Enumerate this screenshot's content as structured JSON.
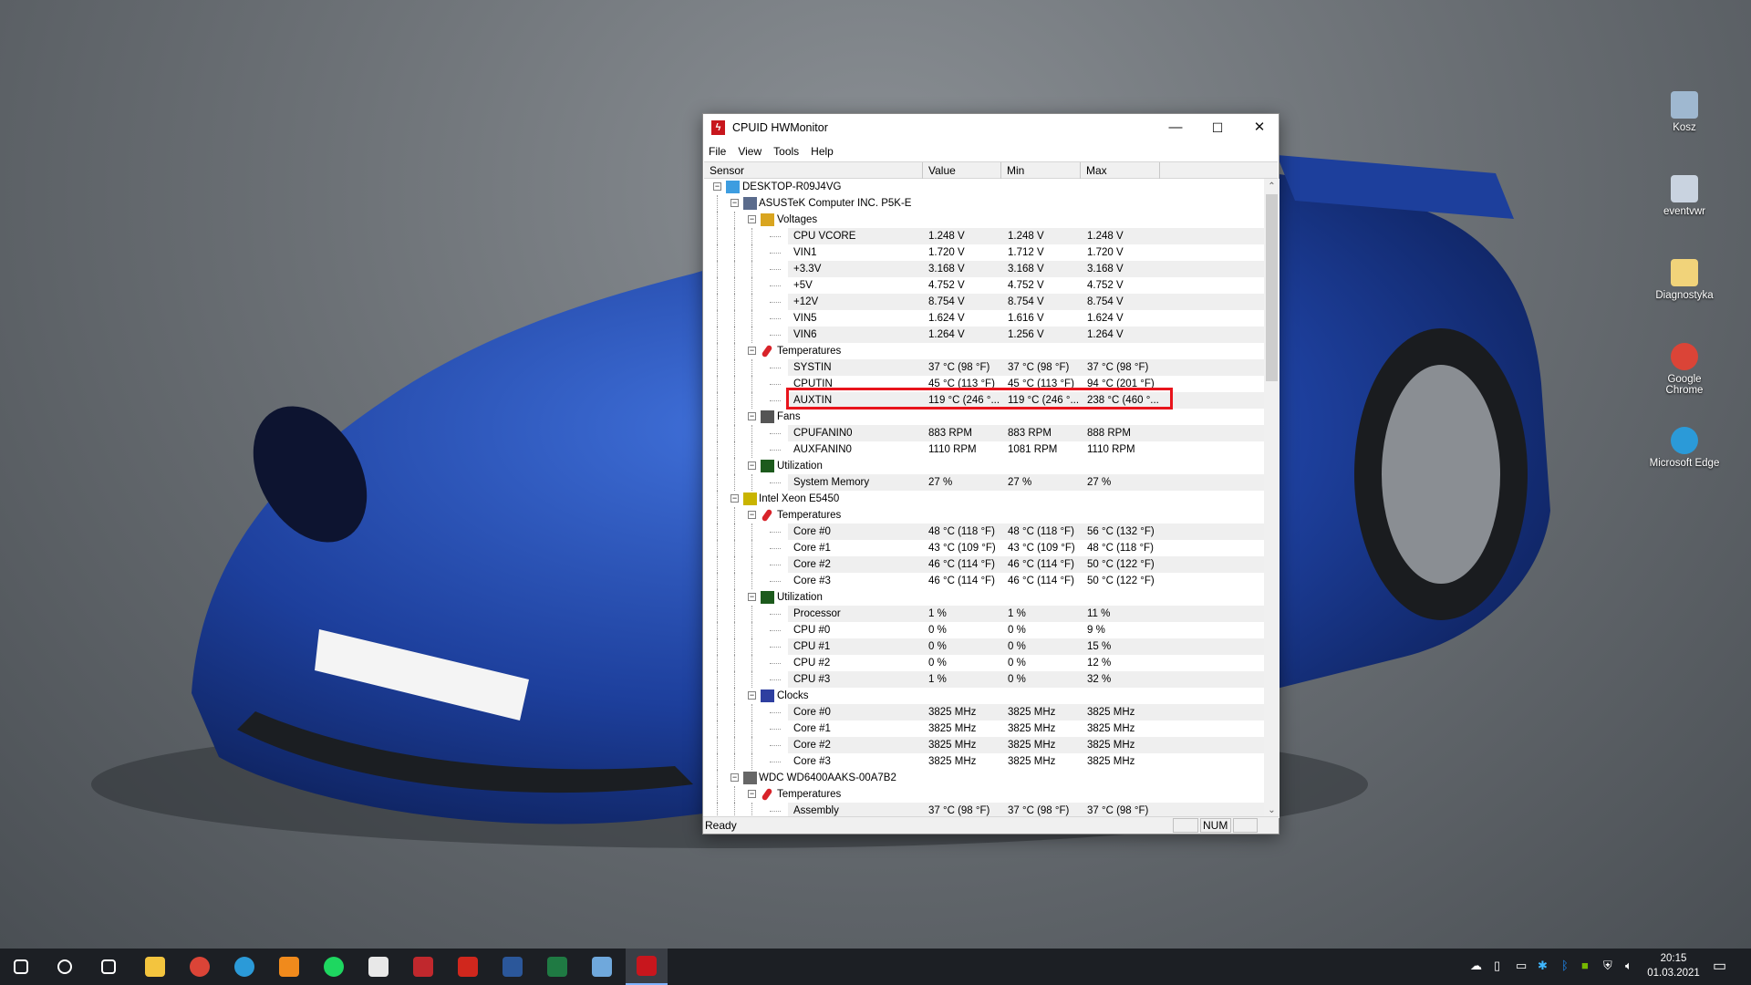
{
  "window": {
    "title": "CPUID HWMonitor",
    "minimize": "—",
    "maximize": "☐",
    "close": "✕"
  },
  "menu": [
    "File",
    "View",
    "Tools",
    "Help"
  ],
  "columns": [
    "Sensor",
    "Value",
    "Min",
    "Max"
  ],
  "rows": [
    {
      "level": 0,
      "kind": "node",
      "icon": "computer-icon",
      "label": "DESKTOP-R09J4VG"
    },
    {
      "level": 1,
      "kind": "node",
      "icon": "motherboard-icon",
      "label": "ASUSTeK Computer INC. P5K-E"
    },
    {
      "level": 2,
      "kind": "node",
      "icon": "voltage-icon",
      "label": "Voltages"
    },
    {
      "kind": "leaf",
      "band": true,
      "label": "CPU VCORE",
      "value": "1.248 V",
      "min": "1.248 V",
      "max": "1.248 V"
    },
    {
      "kind": "leaf",
      "band": false,
      "label": "VIN1",
      "value": "1.720 V",
      "min": "1.712 V",
      "max": "1.720 V"
    },
    {
      "kind": "leaf",
      "band": true,
      "label": "+3.3V",
      "value": "3.168 V",
      "min": "3.168 V",
      "max": "3.168 V"
    },
    {
      "kind": "leaf",
      "band": false,
      "label": "+5V",
      "value": "4.752 V",
      "min": "4.752 V",
      "max": "4.752 V"
    },
    {
      "kind": "leaf",
      "band": true,
      "label": "+12V",
      "value": "8.754 V",
      "min": "8.754 V",
      "max": "8.754 V"
    },
    {
      "kind": "leaf",
      "band": false,
      "label": "VIN5",
      "value": "1.624 V",
      "min": "1.616 V",
      "max": "1.624 V"
    },
    {
      "kind": "leaf",
      "band": true,
      "label": "VIN6",
      "value": "1.264 V",
      "min": "1.256 V",
      "max": "1.264 V"
    },
    {
      "level": 2,
      "kind": "node",
      "icon": "thermometer-icon",
      "label": "Temperatures"
    },
    {
      "kind": "leaf",
      "band": true,
      "label": "SYSTIN",
      "value": "37 °C  (98 °F)",
      "min": "37 °C  (98 °F)",
      "max": "37 °C  (98 °F)"
    },
    {
      "kind": "leaf",
      "band": false,
      "label": "CPUTIN",
      "value": "45 °C  (113 °F)",
      "min": "45 °C  (113 °F)",
      "max": "94 °C  (201 °F)"
    },
    {
      "kind": "leaf",
      "band": true,
      "label": "AUXTIN",
      "value": "119 °C  (246 °...",
      "min": "119 °C  (246 °...",
      "max": "238 °C  (460 °..."
    },
    {
      "level": 2,
      "kind": "node",
      "icon": "fan-icon",
      "label": "Fans"
    },
    {
      "kind": "leaf",
      "band": true,
      "label": "CPUFANIN0",
      "value": "883 RPM",
      "min": "883 RPM",
      "max": "888 RPM"
    },
    {
      "kind": "leaf",
      "band": false,
      "label": "AUXFANIN0",
      "value": "1110 RPM",
      "min": "1081 RPM",
      "max": "1110 RPM"
    },
    {
      "level": 2,
      "kind": "node",
      "icon": "utilization-icon",
      "label": "Utilization"
    },
    {
      "kind": "leaf",
      "band": true,
      "label": "System Memory",
      "value": "27 %",
      "min": "27 %",
      "max": "27 %"
    },
    {
      "level": 1,
      "kind": "node",
      "icon": "cpu-icon",
      "label": "Intel Xeon E5450"
    },
    {
      "level": 2,
      "kind": "node",
      "icon": "thermometer-icon",
      "label": "Temperatures"
    },
    {
      "kind": "leaf",
      "band": true,
      "label": "Core #0",
      "value": "48 °C  (118 °F)",
      "min": "48 °C  (118 °F)",
      "max": "56 °C  (132 °F)"
    },
    {
      "kind": "leaf",
      "band": false,
      "label": "Core #1",
      "value": "43 °C  (109 °F)",
      "min": "43 °C  (109 °F)",
      "max": "48 °C  (118 °F)"
    },
    {
      "kind": "leaf",
      "band": true,
      "label": "Core #2",
      "value": "46 °C  (114 °F)",
      "min": "46 °C  (114 °F)",
      "max": "50 °C  (122 °F)"
    },
    {
      "kind": "leaf",
      "band": false,
      "label": "Core #3",
      "value": "46 °C  (114 °F)",
      "min": "46 °C  (114 °F)",
      "max": "50 °C  (122 °F)"
    },
    {
      "level": 2,
      "kind": "node",
      "icon": "utilization-icon",
      "label": "Utilization"
    },
    {
      "kind": "leaf",
      "band": true,
      "label": "Processor",
      "value": "1 %",
      "min": "1 %",
      "max": "11 %"
    },
    {
      "kind": "leaf",
      "band": false,
      "label": "CPU #0",
      "value": "0 %",
      "min": "0 %",
      "max": "9 %"
    },
    {
      "kind": "leaf",
      "band": true,
      "label": "CPU #1",
      "value": "0 %",
      "min": "0 %",
      "max": "15 %"
    },
    {
      "kind": "leaf",
      "band": false,
      "label": "CPU #2",
      "value": "0 %",
      "min": "0 %",
      "max": "12 %"
    },
    {
      "kind": "leaf",
      "band": true,
      "label": "CPU #3",
      "value": "1 %",
      "min": "0 %",
      "max": "32 %"
    },
    {
      "level": 2,
      "kind": "node",
      "icon": "clock-icon",
      "label": "Clocks"
    },
    {
      "kind": "leaf",
      "band": true,
      "label": "Core #0",
      "value": "3825 MHz",
      "min": "3825 MHz",
      "max": "3825 MHz"
    },
    {
      "kind": "leaf",
      "band": false,
      "label": "Core #1",
      "value": "3825 MHz",
      "min": "3825 MHz",
      "max": "3825 MHz"
    },
    {
      "kind": "leaf",
      "band": true,
      "label": "Core #2",
      "value": "3825 MHz",
      "min": "3825 MHz",
      "max": "3825 MHz"
    },
    {
      "kind": "leaf",
      "band": false,
      "label": "Core #3",
      "value": "3825 MHz",
      "min": "3825 MHz",
      "max": "3825 MHz"
    },
    {
      "level": 1,
      "kind": "node",
      "icon": "hard-drive-icon",
      "label": "WDC WD6400AAKS-00A7B2"
    },
    {
      "level": 2,
      "kind": "node",
      "icon": "thermometer-icon",
      "label": "Temperatures"
    },
    {
      "kind": "leaf",
      "band": true,
      "label": "Assembly",
      "value": "37 °C  (98 °F)",
      "min": "37 °C  (98 °F)",
      "max": "37 °C  (98 °F)"
    }
  ],
  "highlight_row": "AUXTIN",
  "highlight_color": "#e8141c",
  "status": {
    "text": "Ready",
    "num": "NUM"
  },
  "desktop_icons": [
    {
      "label": "Kosz",
      "icon": "recycle-bin-icon",
      "color": "#9fb8d0"
    },
    {
      "label": "eventvwr",
      "icon": "event-viewer-icon",
      "color": "#c9d3e0"
    },
    {
      "label": "Diagnostyka",
      "icon": "folder-icon",
      "color": "#f1d37a"
    },
    {
      "label": "Google Chrome",
      "icon": "chrome-icon",
      "color": "#db4437"
    },
    {
      "label": "Microsoft Edge",
      "icon": "edge-icon",
      "color": "#2b9ad8"
    }
  ],
  "taskbar": [
    {
      "icon": "start-icon",
      "color": "#ffffff"
    },
    {
      "icon": "search-icon",
      "color": "#ffffff"
    },
    {
      "icon": "task-view-icon",
      "color": "#ffffff"
    },
    {
      "icon": "file-explorer-icon",
      "color": "#f3c43e"
    },
    {
      "icon": "chrome-icon",
      "color": "#db4437"
    },
    {
      "icon": "edge-icon",
      "color": "#2b9ad8"
    },
    {
      "icon": "vlc-icon",
      "color": "#f08a1c"
    },
    {
      "icon": "spotify-icon",
      "color": "#1ed760"
    },
    {
      "icon": "fox-app-icon",
      "color": "#e8e8e8"
    },
    {
      "icon": "bug-app-icon",
      "color": "#c0282d"
    },
    {
      "icon": "acrobat-icon",
      "color": "#d0271d"
    },
    {
      "icon": "word-icon",
      "color": "#2b579a"
    },
    {
      "icon": "excel-icon",
      "color": "#1f7a43"
    },
    {
      "icon": "globe-app-icon",
      "color": "#6fa8dc"
    },
    {
      "icon": "hwmonitor-icon",
      "color": "#c8161d",
      "active": true
    }
  ],
  "tray": {
    "time": "20:15",
    "date": "01.03.2021"
  }
}
